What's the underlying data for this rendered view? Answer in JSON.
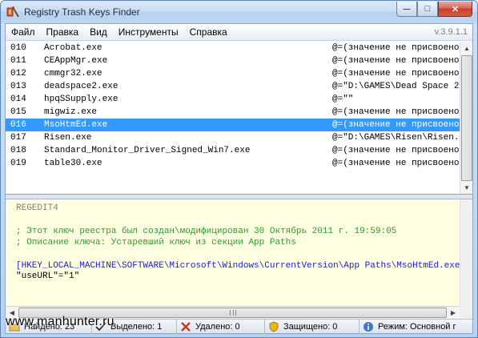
{
  "window": {
    "title": "Registry Trash Keys Finder",
    "buttons": {
      "minimize": "—",
      "maximize": "□",
      "close": "✕"
    }
  },
  "menu": {
    "items": [
      "Файл",
      "Правка",
      "Вид",
      "Инструменты",
      "Справка"
    ],
    "version": "v.3.9.1.1"
  },
  "list": {
    "rows": [
      {
        "num": "010",
        "name": "Acrobat.exe",
        "value": "@=(значение не присвоено)",
        "selected": false
      },
      {
        "num": "011",
        "name": "CEAppMgr.exe",
        "value": "@=(значение не присвоено)",
        "selected": false
      },
      {
        "num": "012",
        "name": "cmmgr32.exe",
        "value": "@=(значение не присвоено)",
        "selected": false
      },
      {
        "num": "013",
        "name": "deadspace2.exe",
        "value": "@=\"D:\\GAMES\\Dead Space 2\"",
        "selected": false
      },
      {
        "num": "014",
        "name": "hpqSSupply.exe",
        "value": "@=\"\"",
        "selected": false
      },
      {
        "num": "015",
        "name": "migwiz.exe",
        "value": "@=(значение не присвоено)",
        "selected": false
      },
      {
        "num": "016",
        "name": "MsoHtmEd.exe",
        "value": "@=(значение не присвоено)",
        "selected": true
      },
      {
        "num": "017",
        "name": "Risen.exe",
        "value": "@=\"D:\\GAMES\\Risen\\Risen.exe\"",
        "selected": false
      },
      {
        "num": "018",
        "name": "Standard_Monitor_Driver_Signed_Win7.exe",
        "value": "@=(значение не присвоено)",
        "selected": false
      },
      {
        "num": "019",
        "name": "table30.exe",
        "value": "@=(значение не присвоено)",
        "selected": false
      }
    ]
  },
  "detail": {
    "header": "REGEDIT4",
    "comment1": "; Этот ключ реестра был создан\\модифицирован 30 Октябрь 2011 г. 19:59:05",
    "comment2": "; Описание ключа: Устаревший ключ из секции App Paths",
    "key": "[HKEY_LOCAL_MACHINE\\SOFTWARE\\Microsoft\\Windows\\CurrentVersion\\App Paths\\MsoHtmEd.exe]",
    "value": "\"useURL\"=\"1\""
  },
  "status": {
    "found": "Найдено: 23",
    "selected": "Выделено: 1",
    "deleted": "Удалено: 0",
    "protected": "Защищено: 0",
    "mode": "Режим: Основной г"
  },
  "watermark": "www.manhunter.ru",
  "colors": {
    "selection": "#3399ff",
    "detail_background": "#ffffe1",
    "comment": "#2e9a2e",
    "key": "#1c1cd6"
  }
}
